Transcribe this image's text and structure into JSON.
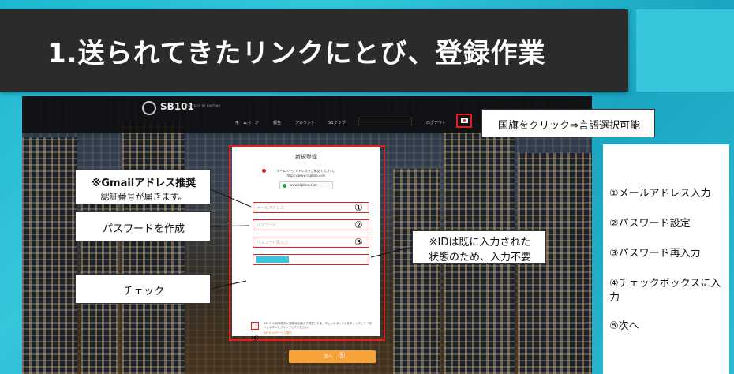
{
  "slide": {
    "title": "1.送られてきたリンクにとび、登録作業"
  },
  "site": {
    "logo_text": "SB101",
    "logo_tagline": "POWERED BY RAPTINO",
    "nav": [
      "ホームページ",
      "報告",
      "アカウント",
      "SBクラブ",
      "ログアウト"
    ],
    "flag_icon": "japan-flag-icon"
  },
  "form": {
    "heading": "新規登録",
    "notice_line1": "ホームページアドレスをご確認ください。",
    "notice_line2": "https://www.raptino.com",
    "url_chip": "www.raptino.com",
    "email_placeholder": "メールアドレス",
    "password_placeholder": "パスワード",
    "password_confirm_placeholder": "パスワード再入力",
    "agreement_text": "SB101の利用規約と最新版で読んで同意した後、チェックボックスをチェックして「次へ」ボタンをクリックしてください。",
    "agreement_link": "SB101のサービス規約",
    "next_label": "次へ",
    "login_hint": "アカウントをお持ちの方ですか。ログインはこちらです。ログイン",
    "markers": [
      "①",
      "②",
      "③",
      "④",
      "⑤"
    ]
  },
  "callouts": {
    "gmail_title": "※Gmailアドレス推奨",
    "gmail_sub": "認証番号が届きます。",
    "password": "パスワードを作成",
    "check": "チェック",
    "id_line1": "※IDは既に入力された",
    "id_line2": "状態のため、入力不要",
    "flag": "国旗をクリック⇒言語選択可能"
  },
  "steps": [
    "①メールアドレス入力",
    "②パスワード設定",
    "③パスワード再入力",
    "④チェックボックスに入力",
    "⑤次へ"
  ],
  "colors": {
    "accent": "#36c6dc",
    "title_bg": "#2b2b2b",
    "highlight": "#e02020",
    "button": "#f6a33b"
  }
}
